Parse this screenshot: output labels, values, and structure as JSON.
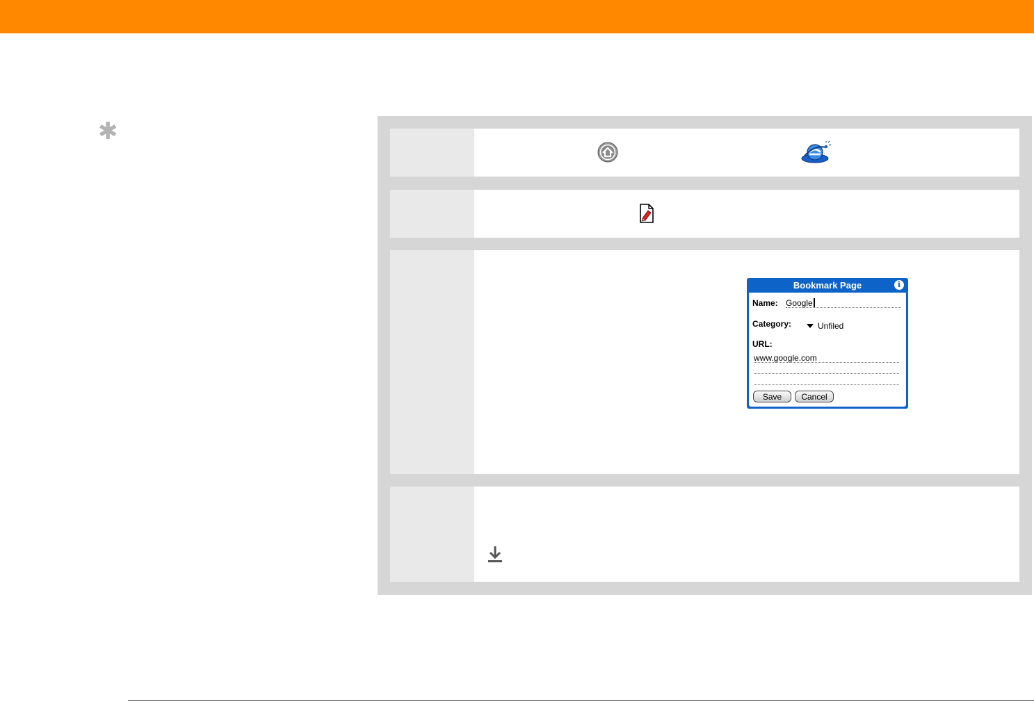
{
  "header": {
    "bar_color": "#ff8800"
  },
  "sidebar": {
    "tip_icon": "asterisk-icon"
  },
  "steps": [
    {
      "icons": [
        "home-icon",
        "web-browser-icon"
      ]
    },
    {
      "icons": [
        "bookmark-page-icon"
      ]
    },
    {
      "dialog": {
        "title": "Bookmark Page",
        "name_label": "Name:",
        "name_value": "Google",
        "category_label": "Category:",
        "category_value": "Unfiled",
        "url_label": "URL:",
        "url_value": "www.google.com",
        "save_label": "Save",
        "cancel_label": "Cancel"
      }
    },
    {
      "icons": [
        "scroll-down-icon"
      ]
    }
  ],
  "colors": {
    "accent": "#ff8800",
    "dialog_blue": "#0e63c8",
    "panel_gray": "#d6d6d6",
    "step_num_gray": "#e9e9e9"
  }
}
